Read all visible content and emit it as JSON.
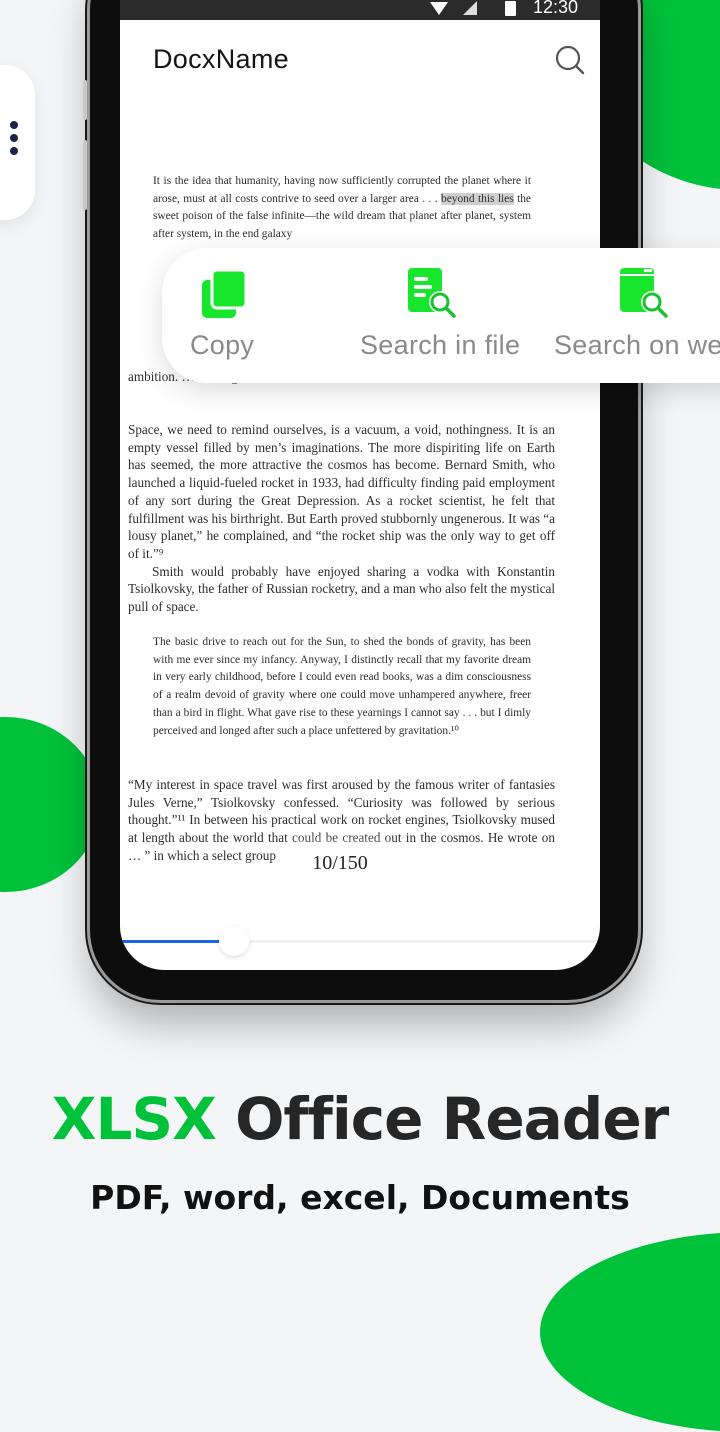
{
  "status_bar": {
    "time": "12:30"
  },
  "app_bar": {
    "title": "DocxName",
    "search_icon": "search-icon"
  },
  "document": {
    "paragraph_1": {
      "before": "It is the idea that humanity, having now sufficiently corrupted the planet where it arose, must at all costs contrive to seed over a larger area . . .",
      "selected": "beyond this lies",
      "after": "the sweet poison of the false infinite—the wild dream that planet after planet, system after system, in the end galaxy"
    },
    "paragraph_2": "ambition. … tine regulations.”⁸",
    "paragraph_3_a": "Space, we need to remind ourselves, is a vacuum, a void, nothingness. It is an empty vessel filled by men’s imaginations. The more dispiriting life on Earth has seemed, the more attractive the cosmos has become. Bernard Smith, who launched a liquid-fueled rocket in 1933, had difficulty finding paid employment of any sort during the Great Depression. As a rocket scientist, he felt that fulfillment was his birthright. But Earth proved stubbornly ungenerous. It was “a lousy planet,” he complained, and “the rocket ship was the only way to get off of it.”⁹",
    "paragraph_3_b": "Smith would probably have enjoyed sharing a vodka with Konstantin Tsiolkovsky, the father of Russian rocketry, and a man who also felt the mystical pull of space.",
    "quote": "The basic drive to reach out for the Sun, to shed the bonds of gravity, has been with me ever since my infancy. Anyway, I distinctly recall that my favorite dream in very early childhood, before I could even read books, was a dim consciousness of a realm devoid of gravity where one could move unhampered anywhere, freer than a bird in flight. What gave rise to these yearnings I cannot say . . . but I dimly perceived and longed after such a place unfettered by gravitation.¹⁰",
    "paragraph_5": "“My interest in space travel was first aroused by the famous writer of fantasies Jules Verne,” Tsiolkovsky confessed. “Curiosity was followed by serious thought.”¹¹ In between his practical work on rocket engines, Tsiolkovsky mused at length about the world that could be created out in the cosmos. He wrote on … ” in which a select group"
  },
  "page_indicator": "10/150",
  "reading_progress": 0.21,
  "context_menu": {
    "items": [
      {
        "label": "Copy",
        "icon": "copy-icon"
      },
      {
        "label": "Search in file",
        "icon": "file-search-icon"
      },
      {
        "label": "Search on web",
        "icon": "web-search-icon"
      }
    ]
  },
  "promo": {
    "headline_accent": "XLSX",
    "headline_rest": " Office Reader",
    "subline": "PDF, word, excel, Documents"
  },
  "colors": {
    "brand_green": "#00c13a",
    "progress_blue": "#1a66e0",
    "kebab_navy": "#1b2346"
  }
}
